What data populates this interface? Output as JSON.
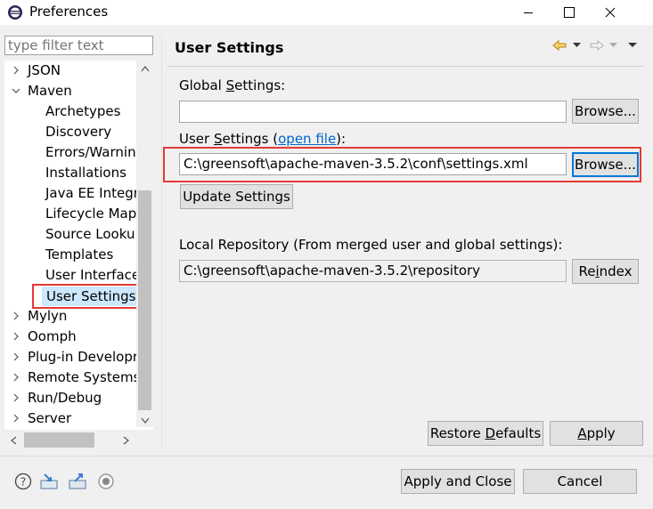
{
  "window": {
    "title": "Preferences"
  },
  "filter": {
    "placeholder": "type filter text"
  },
  "tree": {
    "items": [
      {
        "label": "JSON",
        "expander": "›"
      },
      {
        "label": "Maven",
        "expander": "⌄"
      },
      {
        "label": "Archetypes"
      },
      {
        "label": "Discovery"
      },
      {
        "label": "Errors/Warnin"
      },
      {
        "label": "Installations"
      },
      {
        "label": "Java EE Integra"
      },
      {
        "label": "Lifecycle Map"
      },
      {
        "label": "Source Looku"
      },
      {
        "label": "Templates"
      },
      {
        "label": "User Interface"
      },
      {
        "label": "User Settings",
        "selected": true
      },
      {
        "label": "Mylyn",
        "expander": "›"
      },
      {
        "label": "Oomph",
        "expander": "›"
      },
      {
        "label": "Plug-in Developr",
        "expander": "›"
      },
      {
        "label": "Remote Systems",
        "expander": "›"
      },
      {
        "label": "Run/Debug",
        "expander": "›"
      },
      {
        "label": "Server",
        "expander": "›"
      }
    ]
  },
  "page": {
    "title": "User Settings",
    "global_label_pre": "Global ",
    "global_label_u": "S",
    "global_label_post": "ettings:",
    "global_value": "",
    "browse1": "Browse...",
    "user_label_pre": "User ",
    "user_label_u": "S",
    "user_label_mid": "ettings (",
    "user_label_link": "open file",
    "user_label_post": "):",
    "user_value": "C:\\greensoft\\apache-maven-3.5.2\\conf\\settings.xml",
    "browse2": "Browse...",
    "update_button": "Update Settings",
    "local_repo_label": "Local Repository (From merged user and global settings):",
    "local_repo_value": "C:\\greensoft\\apache-maven-3.5.2\\repository",
    "reindex_pre": "Re",
    "reindex_u": "i",
    "reindex_post": "ndex",
    "restore_pre": "Restore ",
    "restore_u": "D",
    "restore_post": "efaults",
    "apply_pre": "",
    "apply_u": "A",
    "apply_post": "pply"
  },
  "footer": {
    "apply_close": "Apply and Close",
    "cancel": "Cancel"
  },
  "colors": {
    "highlight": "#e53935",
    "selection": "#cce8ff",
    "link": "#0066cc"
  }
}
